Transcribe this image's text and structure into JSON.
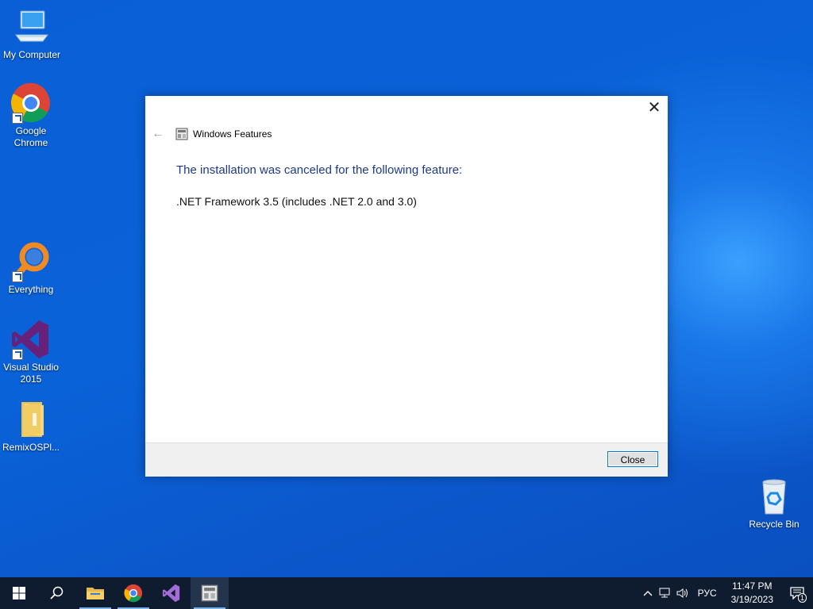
{
  "desktop": {
    "icons": [
      {
        "label": "My Computer",
        "icon": "computer-icon"
      },
      {
        "label": "Google Chrome",
        "icon": "chrome-icon"
      },
      {
        "label": "Everything",
        "icon": "everything-icon"
      },
      {
        "label": "Visual Studio 2015",
        "icon": "visual-studio-icon"
      },
      {
        "label": "RemixOSPl...",
        "icon": "folder-icon"
      },
      {
        "label": "Recycle Bin",
        "icon": "recycle-bin-icon"
      }
    ]
  },
  "dialog": {
    "title": "Windows Features",
    "heading": "The installation was canceled for the following feature:",
    "feature": ".NET Framework 3.5 (includes .NET 2.0 and 3.0)",
    "close_button": "Close",
    "close_glyph": "✕",
    "back_glyph": "←"
  },
  "taskbar": {
    "apps": [
      "start-icon",
      "search-icon",
      "file-explorer-icon",
      "chrome-icon",
      "visual-studio-icon",
      "windows-features-icon"
    ],
    "language": "РУС",
    "time": "11:47 PM",
    "date": "3/19/2023",
    "notification_count": "1"
  },
  "colors": {
    "accent": "#0078d7",
    "heading_blue": "#1d3a8a",
    "taskbar": "#0f1b2e"
  }
}
